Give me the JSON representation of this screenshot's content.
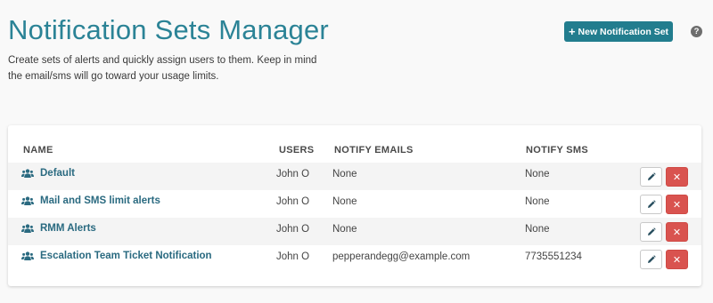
{
  "header": {
    "title": "Notification Sets Manager",
    "description": "Create sets of alerts and quickly assign users to them. Keep in mind the email/sms will go toward your usage limits.",
    "new_button_label": "New Notification Set",
    "new_button_icon": "plus-icon",
    "help_icon": "?"
  },
  "table": {
    "columns": {
      "name": "NAME",
      "users": "USERS",
      "notify_emails": "NOTIFY EMAILS",
      "notify_sms": "NOTIFY SMS"
    },
    "rows": [
      {
        "name": "Default",
        "users": "John O",
        "notify_emails": "None",
        "notify_sms": "None"
      },
      {
        "name": "Mail and SMS limit alerts",
        "users": "John O",
        "notify_emails": "None",
        "notify_sms": "None"
      },
      {
        "name": "RMM Alerts",
        "users": "John O",
        "notify_emails": "None",
        "notify_sms": "None"
      },
      {
        "name": "Escalation Team Ticket Notification",
        "users": "John O",
        "notify_emails": "pepperandegg@example.com",
        "notify_sms": "7735551234"
      }
    ]
  },
  "colors": {
    "title": "#2b8396",
    "primary_button": "#227d8e",
    "delete_button": "#d9534f",
    "set_name": "#2a6a80"
  }
}
